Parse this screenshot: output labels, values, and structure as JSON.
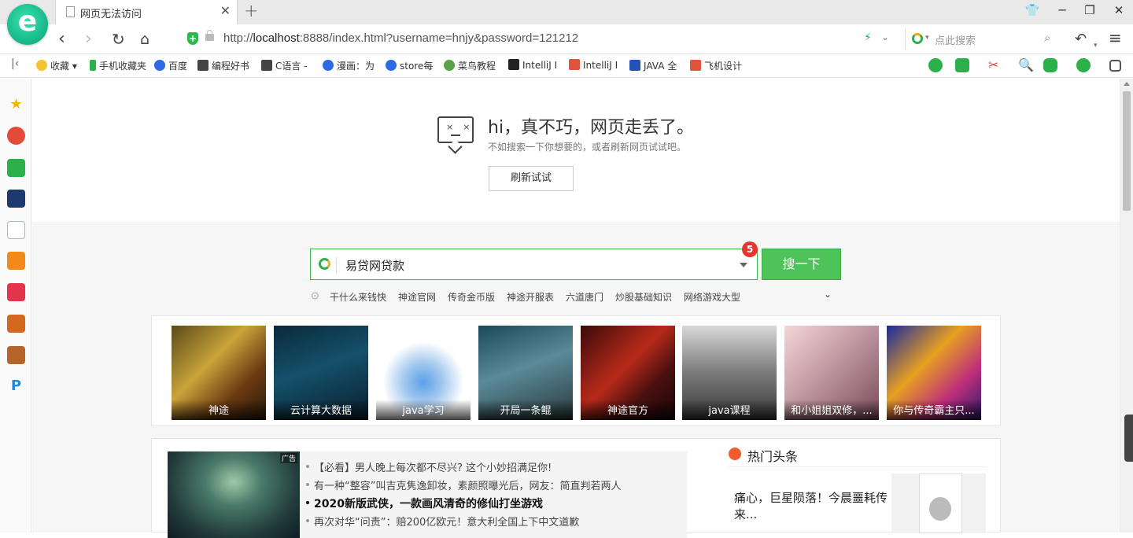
{
  "tab": {
    "title": "网页无法访问"
  },
  "address": {
    "url_prefix": "http://",
    "url_host": "localhost",
    "url_rest": ":8888/index.html?username=hnjy&password=121212",
    "search_placeholder": "点此搜索"
  },
  "bookmarks": [
    {
      "label": "收藏",
      "color": "#f4b400"
    },
    {
      "label": "手机收藏夹",
      "color": "#2bb04a"
    },
    {
      "label": "百度",
      "color": "#2d6be6"
    },
    {
      "label": "编程好书",
      "color": "#444444"
    },
    {
      "label": "C语言 -",
      "color": "#444444"
    },
    {
      "label": "漫画：为",
      "color": "#2d6be6"
    },
    {
      "label": "store每",
      "color": "#2d6be6"
    },
    {
      "label": "菜鸟教程",
      "color": "#5aa14a"
    },
    {
      "label": "IntelliJ I",
      "color": "#222222"
    },
    {
      "label": "IntelliJ I",
      "color": "#e2523c"
    },
    {
      "label": "JAVA 全",
      "color": "#2452b8"
    },
    {
      "label": "飞机设计",
      "color": "#e2523c"
    }
  ],
  "error": {
    "title": "hi，真不巧，网页走丢了。",
    "subtitle": "不如搜索一下你想要的，或者刷新网页试试吧。",
    "retry_label": "刷新试试"
  },
  "search": {
    "query": "易贷网贷款",
    "badge": "5",
    "button_label": "搜一下",
    "hot_keywords": [
      "干什么来钱快",
      "神途官网",
      "传奇金币版",
      "神途开服表",
      "六道唐门",
      "炒股基础知识",
      "网络游戏大型"
    ]
  },
  "tiles": [
    {
      "caption": "神途"
    },
    {
      "caption": "云计算大数据"
    },
    {
      "caption": "java学习"
    },
    {
      "caption": "开局一条鲲"
    },
    {
      "caption": "神途官方"
    },
    {
      "caption": "java课程"
    },
    {
      "caption": "和小姐姐双修，..."
    },
    {
      "caption": "你与传奇霸主只..."
    }
  ],
  "ad": {
    "tag": "广告",
    "lines": [
      "【必看】男人晚上每次都不尽兴? 这个小妙招满足你!",
      "有一种“整容”叫吉克隽逸卸妆，素颜照曝光后，网友：简直判若两人",
      "2020新版武侠，一款画风清奇的修仙打坐游戏",
      "再次对华“问责”：赔200亿欧元！意大利全国上下中文道歉"
    ]
  },
  "hot_news": {
    "title": "热门头条",
    "item": "痛心，巨星陨落！今晨噩耗传来..."
  }
}
